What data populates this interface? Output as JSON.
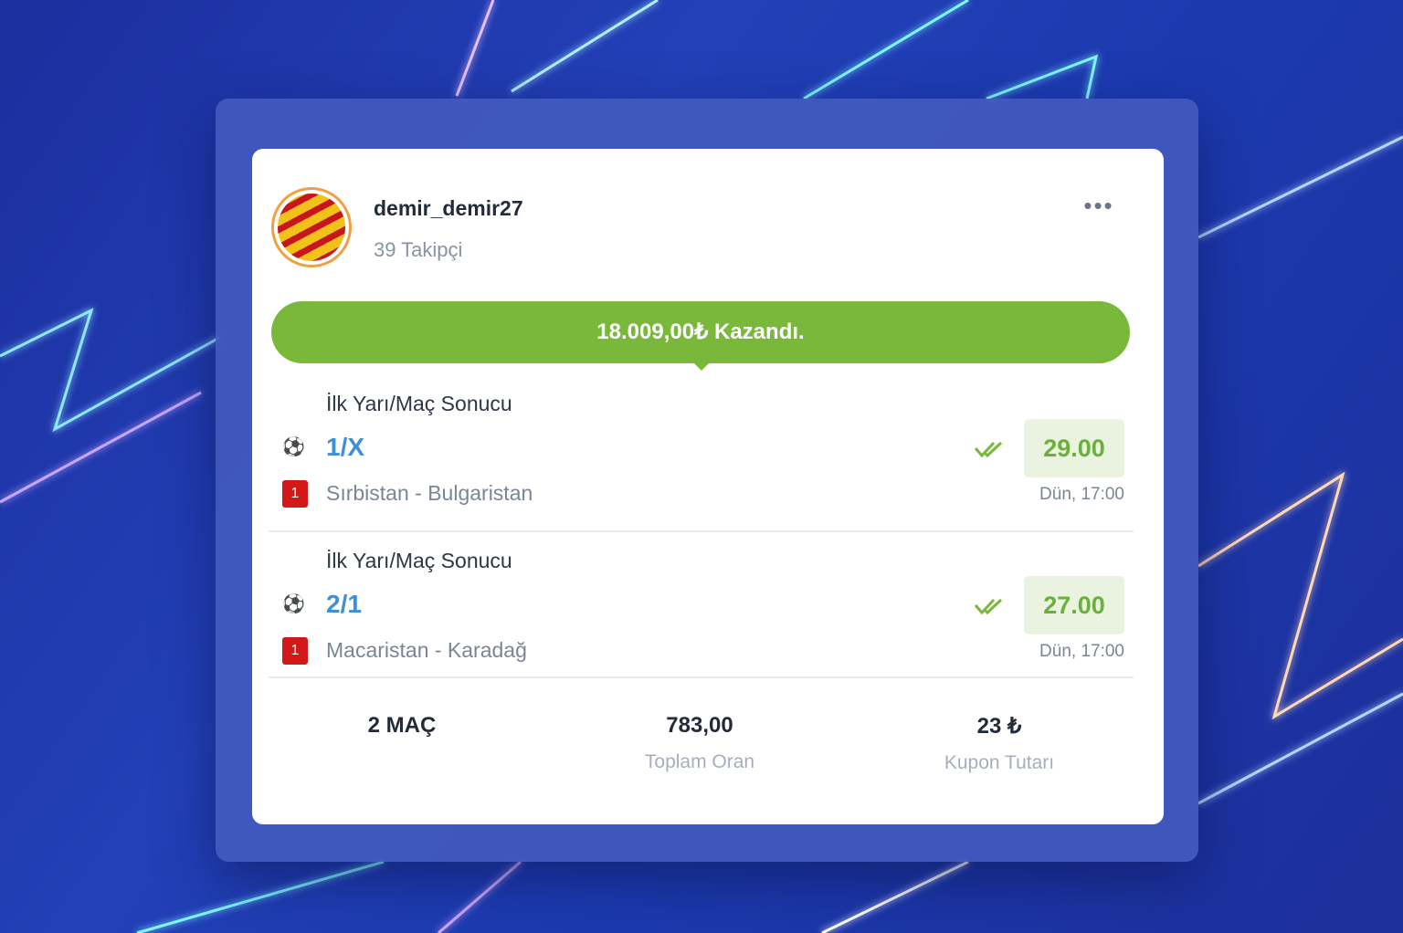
{
  "profile": {
    "username": "demir_demir27",
    "followers": "39 Takipçi",
    "avatar_icon": "striped-flag-avatar",
    "more_label": "•••"
  },
  "banner": {
    "text": "18.009,00₺ Kazandı.",
    "color": "#7ab83c"
  },
  "bets": [
    {
      "market": "İlk Yarı/Maç Sonucu",
      "pick": "1/X",
      "odd": "29.00",
      "badge": "1",
      "teams": "Sırbistan - Bulgaristan",
      "time": "Dün, 17:00",
      "status": "won",
      "sport_icon": "soccer-ball-icon"
    },
    {
      "market": "İlk Yarı/Maç Sonucu",
      "pick": "2/1",
      "odd": "27.00",
      "badge": "1",
      "teams": "Macaristan - Karadağ",
      "time": "Dün, 17:00",
      "status": "won",
      "sport_icon": "soccer-ball-icon"
    }
  ],
  "summary": {
    "matches": "2 MAÇ",
    "total_odds": "783,00",
    "total_odds_label": "Toplam Oran",
    "stake": "23 ₺",
    "stake_label": "Kupon Tutarı"
  },
  "colors": {
    "pick": "#3f8fd6",
    "odd_text": "#6ab03a",
    "odd_bg": "#eaf3e0",
    "badge": "#d31818"
  }
}
